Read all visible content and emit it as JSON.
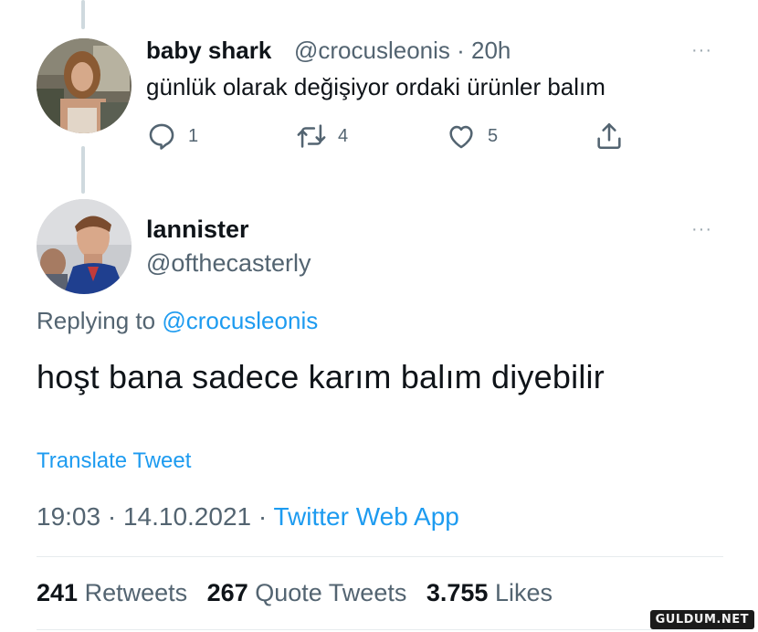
{
  "reply_tweet": {
    "display_name": "baby shark",
    "handle": "@crocusleonis",
    "separator": " · ",
    "time": "20h",
    "text": "günlük olarak değişiyor ordaki ürünler balım",
    "more": "···",
    "actions": {
      "replies": "1",
      "retweets": "4",
      "likes": "5"
    }
  },
  "main_tweet": {
    "display_name": "lannister",
    "handle": "@ofthecasterly",
    "more": "···",
    "replying_prefix": "Replying to ",
    "replying_to": "@crocusleonis",
    "text": "hoşt bana sadece karım balım diyebilir",
    "translate_label": "Translate Tweet",
    "time": "19:03 · 14.10.2021",
    "meta_separator": " · ",
    "source": "Twitter Web App",
    "stats": {
      "retweets_count": "241",
      "retweets_label": "Retweets",
      "quote_count": "267",
      "quote_label": "Quote Tweets",
      "likes_count": "3.755",
      "likes_label": "Likes"
    }
  },
  "watermark": "GULDUM.NET",
  "colors": {
    "link": "#1d9bf0",
    "secondary_text": "#536471",
    "primary_text": "#0f1419"
  },
  "icons": [
    "reply-icon",
    "retweet-icon",
    "like-icon",
    "share-icon",
    "more-icon"
  ]
}
